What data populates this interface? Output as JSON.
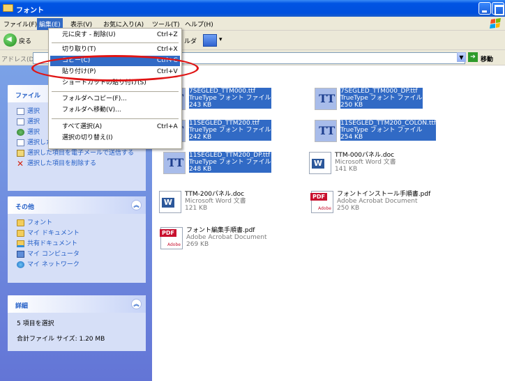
{
  "window": {
    "title": "フォント"
  },
  "menubar": {
    "items": [
      "ファイル(F)",
      "編集(E)",
      "表示(V)",
      "お気に入り(A)",
      "ツール(T)",
      "ヘルプ(H)"
    ]
  },
  "toolbar": {
    "back_label": "戻る",
    "folders_label": "ルダ"
  },
  "addressbar": {
    "label": "アドレス(D)",
    "go_label": "移動"
  },
  "edit_menu": {
    "items": [
      {
        "label": "元に戻す - 削除(U)",
        "shortcut": "Ctrl+Z"
      },
      {
        "label": "切り取り(T)",
        "shortcut": "Ctrl+X"
      },
      {
        "label": "コピー(C)",
        "shortcut": "Ctrl+C"
      },
      {
        "label": "貼り付け(P)",
        "shortcut": "Ctrl+V"
      },
      {
        "label": "ショートカットの貼り付け(S)",
        "shortcut": ""
      },
      {
        "label": "フォルダへコピー(F)...",
        "shortcut": ""
      },
      {
        "label": "フォルダへ移動(V)...",
        "shortcut": ""
      },
      {
        "label": "すべて選択(A)",
        "shortcut": "Ctrl+A"
      },
      {
        "label": "選択の切り替え(I)",
        "shortcut": ""
      }
    ]
  },
  "sidebar": {
    "file_tasks": {
      "title": "ファイル",
      "items": [
        "選択",
        "選択",
        "選択",
        "選択した項目を電子メールで送信する",
        "選択した項目を削除する"
      ]
    },
    "other": {
      "title": "その他",
      "items": [
        "フォント",
        "マイ ドキュメント",
        "共有ドキュメント",
        "マイ コンピュータ",
        "マイ ネットワーク"
      ]
    },
    "details": {
      "title": "詳細",
      "selected": "5 項目を選択",
      "total_size": "合計ファイル サイズ: 1.20 MB"
    }
  },
  "files": [
    {
      "name": "7SEGLED_TTM000.ttf",
      "type": "TrueType フォント ファイル",
      "size": "243 KB",
      "icon": "truetype-font-icon",
      "selected": true
    },
    {
      "name": "7SEGLED_TTM000_DP.ttf",
      "type": "TrueType フォント ファイル",
      "size": "250 KB",
      "icon": "truetype-font-icon",
      "selected": true
    },
    {
      "name": "11SEGLED_TTM200.ttf",
      "type": "TrueType フォント ファイル",
      "size": "242 KB",
      "icon": "truetype-font-icon",
      "selected": true
    },
    {
      "name": "11SEGLED_TTM200_COLON.ttf",
      "type": "TrueType フォント ファイル",
      "size": "254 KB",
      "icon": "truetype-font-icon",
      "selected": true
    },
    {
      "name": "11SEGLED_TTM200_DP.ttf",
      "type": "TrueType フォント ファイル",
      "size": "248 KB",
      "icon": "truetype-font-icon",
      "selected": true
    },
    {
      "name": "TTM-000パネル.doc",
      "type": "Microsoft Word 文書",
      "size": "141 KB",
      "icon": "word-document-icon",
      "selected": false
    },
    {
      "name": "TTM-200パネル.doc",
      "type": "Microsoft Word 文書",
      "size": "121 KB",
      "icon": "word-document-icon",
      "selected": false
    },
    {
      "name": "フォントインストール手順書.pdf",
      "type": "Adobe Acrobat Document",
      "size": "250 KB",
      "icon": "pdf-document-icon",
      "selected": false
    },
    {
      "name": "フォント編集手順書.pdf",
      "type": "Adobe Acrobat Document",
      "size": "269 KB",
      "icon": "pdf-document-icon",
      "selected": false
    }
  ],
  "colors": {
    "selection": "#316ac5",
    "annotation": "#e01515",
    "titlebar": "#0054e3"
  }
}
